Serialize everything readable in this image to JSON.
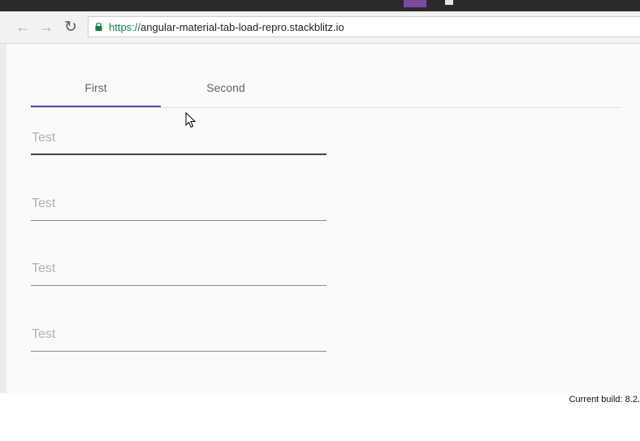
{
  "browser": {
    "url_scheme": "https://",
    "url_host": "angular-material-tab-load-repro.stackblitz.io",
    "back_icon": "arrow-left-icon",
    "forward_icon": "arrow-right-icon",
    "reload_icon": "reload-icon",
    "secure_icon": "lock-icon",
    "secure_color": "#0b8043"
  },
  "tabs": [
    {
      "label": "First",
      "active": true
    },
    {
      "label": "Second",
      "active": false
    }
  ],
  "accent_color": "#673ab7",
  "fields": [
    {
      "placeholder": "Test",
      "value": "",
      "focused": true
    },
    {
      "placeholder": "Test",
      "value": "",
      "focused": false
    },
    {
      "placeholder": "Test",
      "value": "",
      "focused": false
    },
    {
      "placeholder": "Test",
      "value": "",
      "focused": false
    }
  ],
  "footer": {
    "build_text": "Current build: 8.2."
  }
}
